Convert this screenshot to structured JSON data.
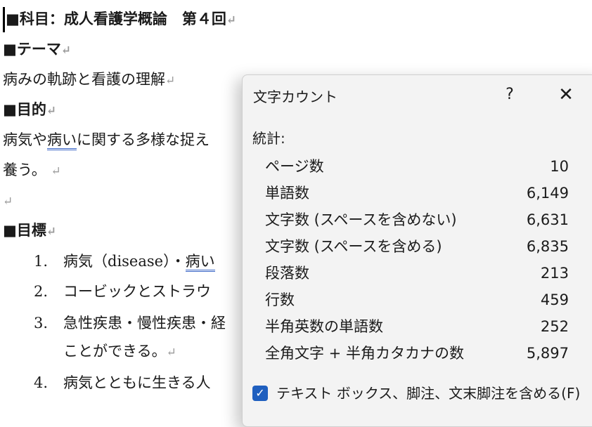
{
  "document": {
    "subject_heading": "■科目：成人看護学概論　第４回",
    "theme_heading": "■テーマ",
    "theme_text": "病みの軌跡と看護の理解",
    "purpose_heading": "■目的",
    "purpose_text_1a": "病気や",
    "purpose_text_1b": "病い",
    "purpose_text_1c": "に関する多様な捉え",
    "purpose_text_2": "養う。",
    "goals_heading": "■目標",
    "goals": [
      {
        "num": "1.",
        "text_a": "病気（disease）・",
        "text_b": "病い"
      },
      {
        "num": "2.",
        "text_a": "コービックとストラウ"
      },
      {
        "num": "3.",
        "text_a": "急性疾患・慢性疾患・経"
      },
      {
        "num": "",
        "text_a": "ことができる。"
      },
      {
        "num": "4.",
        "text_a": "病気とともに生きる人"
      }
    ],
    "paragraph_mark": "↵"
  },
  "dialog": {
    "title": "文字カウント",
    "help_label": "?",
    "close_label": "✕",
    "stats_label": "統計:",
    "stats": [
      {
        "label": "ページ数",
        "value": "10"
      },
      {
        "label": "単語数",
        "value": "6,149"
      },
      {
        "label": "文字数 (スペースを含めない)",
        "value": "6,631"
      },
      {
        "label": "文字数 (スペースを含める)",
        "value": "6,835"
      },
      {
        "label": "段落数",
        "value": "213"
      },
      {
        "label": "行数",
        "value": "459"
      },
      {
        "label": "半角英数の単語数",
        "value": "252"
      },
      {
        "label": "全角文字 + 半角カタカナの数",
        "value": "5,897"
      }
    ],
    "checkbox_label": "テキスト ボックス、脚注、文末脚注を含める(F)",
    "checkbox_checked": true,
    "checkbox_glyph": "✓"
  }
}
